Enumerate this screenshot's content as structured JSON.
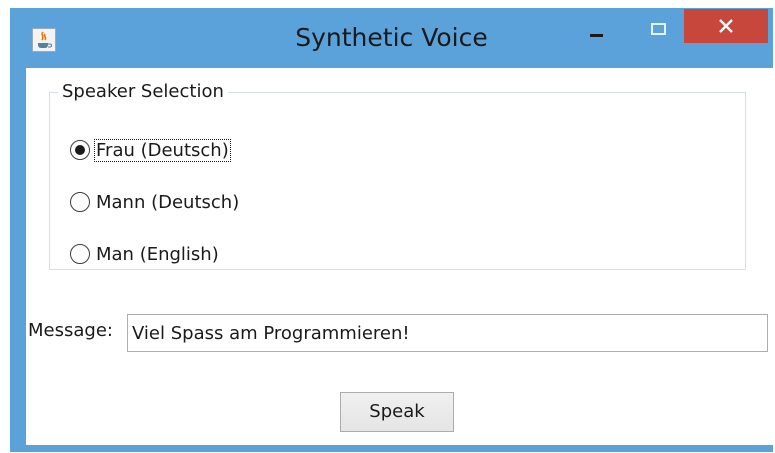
{
  "window": {
    "title": "Synthetic Voice",
    "icon": "java-cup-icon",
    "controls": [
      "minimize",
      "maximize",
      "close"
    ]
  },
  "speaker_selection": {
    "label": "Speaker Selection",
    "options": [
      {
        "label": "Frau (Deutsch)",
        "selected": true
      },
      {
        "label": "Mann (Deutsch)",
        "selected": false
      },
      {
        "label": "Man (English)",
        "selected": false
      }
    ]
  },
  "message": {
    "label": "Message:",
    "value": "Viel Spass am Programmieren!"
  },
  "speak_button": {
    "label": "Speak"
  },
  "colors": {
    "titlebar": "#5ba2db",
    "close_button": "#c7473c"
  }
}
